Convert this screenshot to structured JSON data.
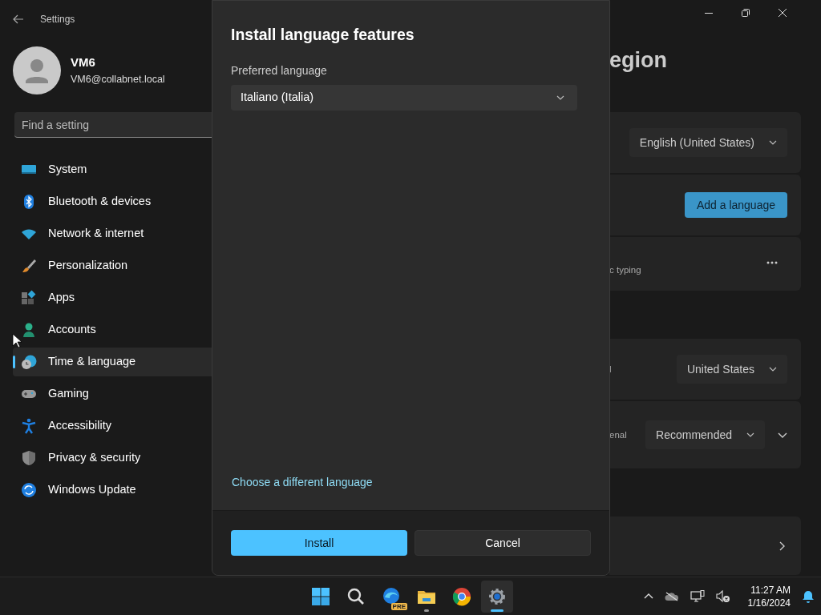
{
  "window": {
    "title": "Settings"
  },
  "account": {
    "name": "VM6",
    "email": "VM6@collabnet.local"
  },
  "search": {
    "placeholder": "Find a setting"
  },
  "nav": [
    {
      "label": "System",
      "selected": false
    },
    {
      "label": "Bluetooth & devices",
      "selected": false
    },
    {
      "label": "Network & internet",
      "selected": false
    },
    {
      "label": "Personalization",
      "selected": false
    },
    {
      "label": "Apps",
      "selected": false
    },
    {
      "label": "Accounts",
      "selected": false
    },
    {
      "label": "Time & language",
      "selected": true
    },
    {
      "label": "Gaming",
      "selected": false
    },
    {
      "label": "Accessibility",
      "selected": false
    },
    {
      "label": "Privacy & security",
      "selected": false
    },
    {
      "label": "Windows Update",
      "selected": false
    }
  ],
  "content": {
    "title": "egion",
    "sections": [
      {
        "cards": [
          {
            "kind": "dropdown",
            "value": "English (United States)"
          },
          {
            "kind": "button",
            "label": "Add a language"
          },
          {
            "kind": "more",
            "text": "c typing"
          }
        ]
      },
      {
        "cards": [
          {
            "kind": "dropdown",
            "text": "l",
            "value": "United States"
          },
          {
            "kind": "dropdown",
            "text": "enal",
            "value": "Recommended",
            "expandable": true
          }
        ]
      },
      {
        "cards": [
          {
            "kind": "link"
          }
        ]
      }
    ]
  },
  "dialog": {
    "title": "Install language features",
    "field_label": "Preferred language",
    "language": "Italiano (Italia)",
    "link": "Choose a different language",
    "buttons": [
      {
        "label": "Install",
        "primary": true
      },
      {
        "label": "Cancel",
        "primary": false
      }
    ]
  },
  "taskbar": {
    "apps": [
      {
        "selected": false,
        "running": false
      },
      {
        "selected": false,
        "running": false
      },
      {
        "selected": false,
        "running": false,
        "badge": "PRE"
      },
      {
        "selected": false,
        "running": true
      },
      {
        "selected": false,
        "running": false
      },
      {
        "selected": true,
        "running": true
      }
    ],
    "clock": {
      "time": "11:27 AM",
      "date": "1/16/2024"
    }
  }
}
